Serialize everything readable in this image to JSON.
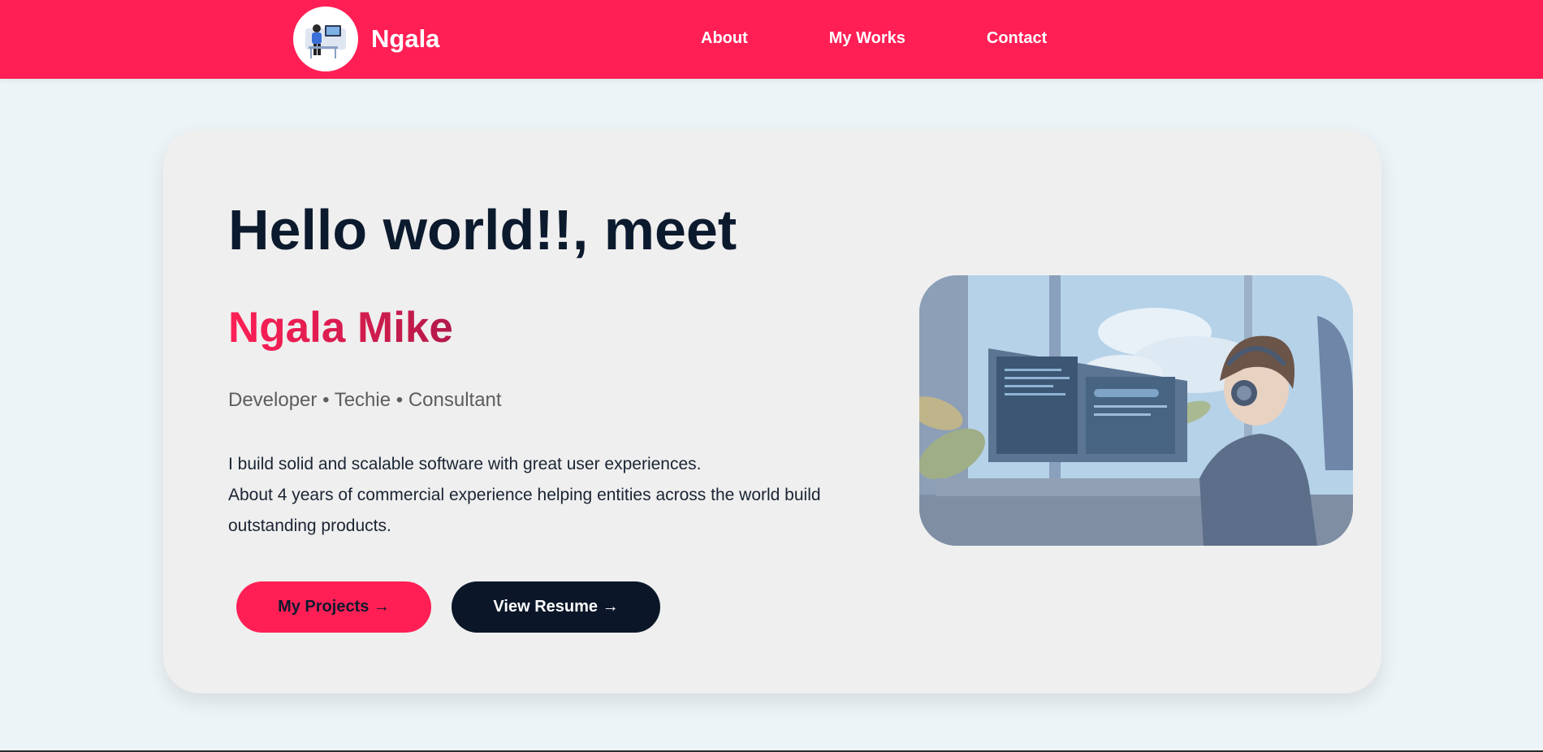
{
  "nav": {
    "brand_name": "Ngala",
    "links": [
      {
        "label": "About"
      },
      {
        "label": "My Works"
      },
      {
        "label": "Contact"
      }
    ]
  },
  "hero": {
    "headline": "Hello world!!, meet",
    "name": "Ngala Mike",
    "roles": "Developer • Techie • Consultant",
    "bio_lines": [
      "I build solid and scalable software with great user experiences.",
      "About 4 years of commercial experience helping entities across the world build",
      "outstanding products."
    ],
    "buttons": {
      "projects_label": "My Projects →",
      "resume_label": "View Resume →"
    }
  },
  "colors": {
    "nav_bg": "#ff1f55",
    "accent": "#ff1f55",
    "dark": "#0b1729",
    "page_bg": "#edf4f7",
    "card_bg": "#efefef"
  },
  "icons": {
    "logo": "developer-at-desk-illustration",
    "hero_image": "anime-coder-at-monitors-illustration"
  }
}
